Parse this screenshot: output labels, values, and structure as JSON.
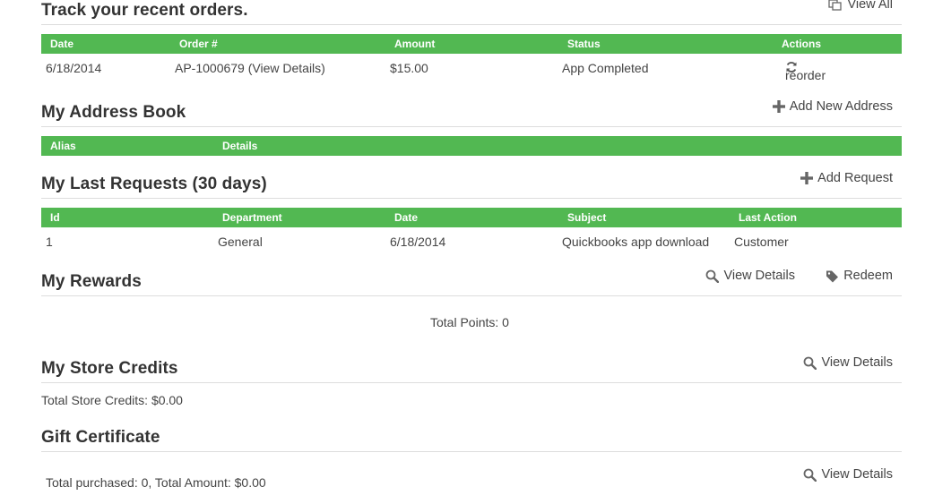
{
  "orders": {
    "title": "Track your recent orders.",
    "view_all": "View All",
    "columns": [
      "Date",
      "Order #",
      "Amount",
      "Status",
      "Actions"
    ],
    "rows": [
      {
        "date": "6/18/2014",
        "order": "AP-1000679 (View Details)",
        "amount": "$15.00",
        "status": "App Completed",
        "action": "reorder"
      }
    ]
  },
  "address_book": {
    "title": "My Address Book",
    "add_label": "Add New Address",
    "columns": [
      "Alias",
      "Details"
    ]
  },
  "requests": {
    "title": "My Last Requests (30 days)",
    "add_label": "Add Request",
    "columns": [
      "Id",
      "Department",
      "Date",
      "Subject",
      "Last Action"
    ],
    "rows": [
      {
        "id": "1",
        "department": "General",
        "date": "6/18/2014",
        "subject": "Quickbooks app download",
        "last_action": "Customer"
      }
    ]
  },
  "rewards": {
    "title": "My Rewards",
    "view_label": "View Details",
    "redeem_label": "Redeem",
    "total_points": "Total Points: 0"
  },
  "store_credits": {
    "title": "My Store Credits",
    "view_label": "View Details",
    "total": "Total Store Credits: $0.00"
  },
  "gift_certificate": {
    "title": "Gift Certificate",
    "view_label": "View Details",
    "summary": "Total purchased: 0, Total Amount: $0.00"
  },
  "colors": {
    "table_header": "#52b852",
    "divider": "#dddddd",
    "text": "#333333"
  }
}
